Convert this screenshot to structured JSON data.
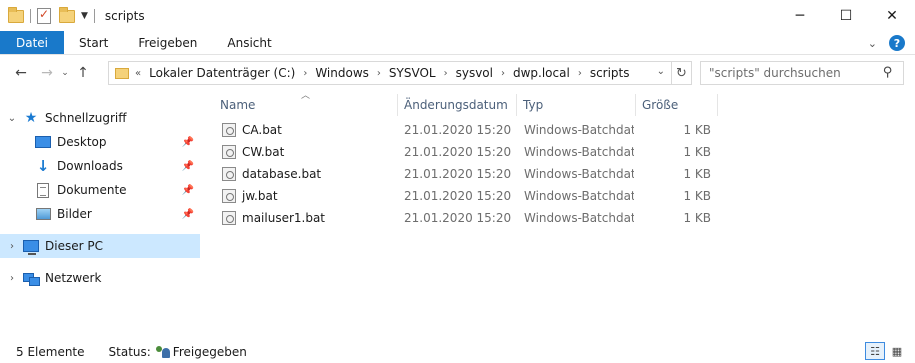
{
  "window": {
    "title": "scripts",
    "minimize_icon": "minimize-icon",
    "maximize_icon": "maximize-icon",
    "close_icon": "close-icon"
  },
  "ribbon": {
    "tabs": [
      {
        "label": "Datei",
        "active": true
      },
      {
        "label": "Start"
      },
      {
        "label": "Freigeben"
      },
      {
        "label": "Ansicht"
      }
    ],
    "accent_color": "#1979ca"
  },
  "navigation": {
    "breadcrumb_overflow": "«",
    "breadcrumb": [
      "Lokaler Datenträger (C:)",
      "Windows",
      "SYSVOL",
      "sysvol",
      "dwp.local",
      "scripts"
    ],
    "search_placeholder": "\"scripts\" durchsuchen"
  },
  "sidebar": {
    "items": [
      {
        "label": "Schnellzugriff",
        "icon": "star-icon",
        "expanded": true
      },
      {
        "label": "Desktop",
        "icon": "desktop-icon",
        "pinned": true
      },
      {
        "label": "Downloads",
        "icon": "download-arrow-icon",
        "pinned": true
      },
      {
        "label": "Dokumente",
        "icon": "documents-icon",
        "pinned": true
      },
      {
        "label": "Bilder",
        "icon": "pictures-icon",
        "pinned": true
      },
      {
        "label": "Dieser PC",
        "icon": "computer-icon",
        "selected": true
      },
      {
        "label": "Netzwerk",
        "icon": "network-icon"
      }
    ]
  },
  "columns": {
    "name": "Name",
    "date": "Änderungsdatum",
    "type": "Typ",
    "size": "Größe"
  },
  "files": [
    {
      "name": "CA.bat",
      "date": "21.01.2020 15:20",
      "type": "Windows-Batchdatei",
      "size": "1 KB"
    },
    {
      "name": "CW.bat",
      "date": "21.01.2020 15:20",
      "type": "Windows-Batchdatei",
      "size": "1 KB"
    },
    {
      "name": "database.bat",
      "date": "21.01.2020 15:20",
      "type": "Windows-Batchdatei",
      "size": "1 KB"
    },
    {
      "name": "jw.bat",
      "date": "21.01.2020 15:20",
      "type": "Windows-Batchdatei",
      "size": "1 KB"
    },
    {
      "name": "mailuser1.bat",
      "date": "21.01.2020 15:20",
      "type": "Windows-Batchdatei",
      "size": "1 KB"
    }
  ],
  "statusbar": {
    "count": "5 Elemente",
    "status_label": "Status:",
    "status_value": "Freigegeben"
  }
}
